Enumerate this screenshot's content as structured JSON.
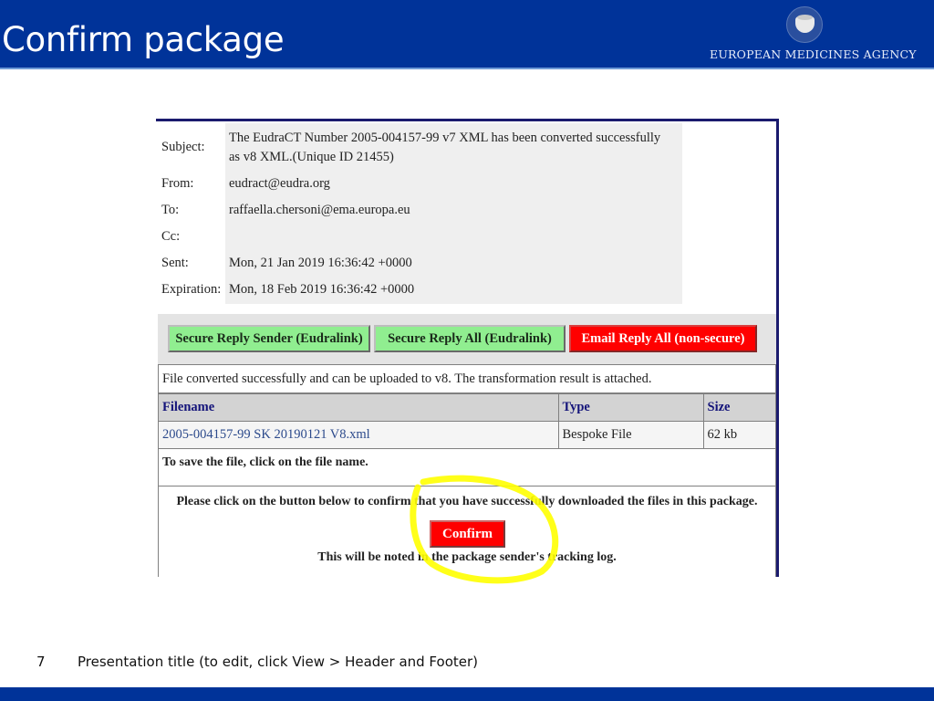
{
  "slide": {
    "title": "Confirm package",
    "logo_text": "EUROPEAN MEDICINES AGENCY",
    "page_number": "7",
    "footer_text": "Presentation title (to edit, click View > Header and Footer)"
  },
  "colors": {
    "brand_blue": "#003399",
    "secure_button": "#90ee90",
    "insecure_button": "#ff0000",
    "highlight": "#ffff00"
  },
  "email": {
    "fields": [
      {
        "label": "Subject:",
        "value_line1": "The EudraCT Number 2005-004157-99 v7 XML has been converted successfully",
        "value_line2": "as v8 XML.(Unique ID 21455)"
      },
      {
        "label": "From:",
        "value": "eudract@eudra.org"
      },
      {
        "label": "To:",
        "value": "raffaella.chersoni@ema.europa.eu"
      },
      {
        "label": "Cc:",
        "value": ""
      },
      {
        "label": "Sent:",
        "value": "Mon, 21 Jan 2019 16:36:42 +0000"
      },
      {
        "label": "Expiration:",
        "value": "Mon, 18 Feb 2019 16:36:42 +0000"
      }
    ]
  },
  "actions": {
    "reply_sender": "Secure Reply Sender (Eudralink)",
    "reply_all": "Secure Reply All (Eudralink)",
    "email_reply_all": "Email Reply All (non-secure)"
  },
  "package": {
    "notice": "File converted successfully and can be uploaded to v8. The transformation result is attached.",
    "columns": [
      "Filename",
      "Type",
      "Size"
    ],
    "files": [
      {
        "filename": "2005-004157-99 SK 20190121 V8.xml",
        "type": "Bespoke File",
        "size": "62 kb"
      }
    ],
    "save_hint": "To save the file, click on the file name.",
    "confirm_instruction": "Please click on the button below to confirm that you have successfully downloaded the files in this package.",
    "confirm_label": "Confirm",
    "tracking_note": "This will be noted in the package sender's tracking log."
  }
}
